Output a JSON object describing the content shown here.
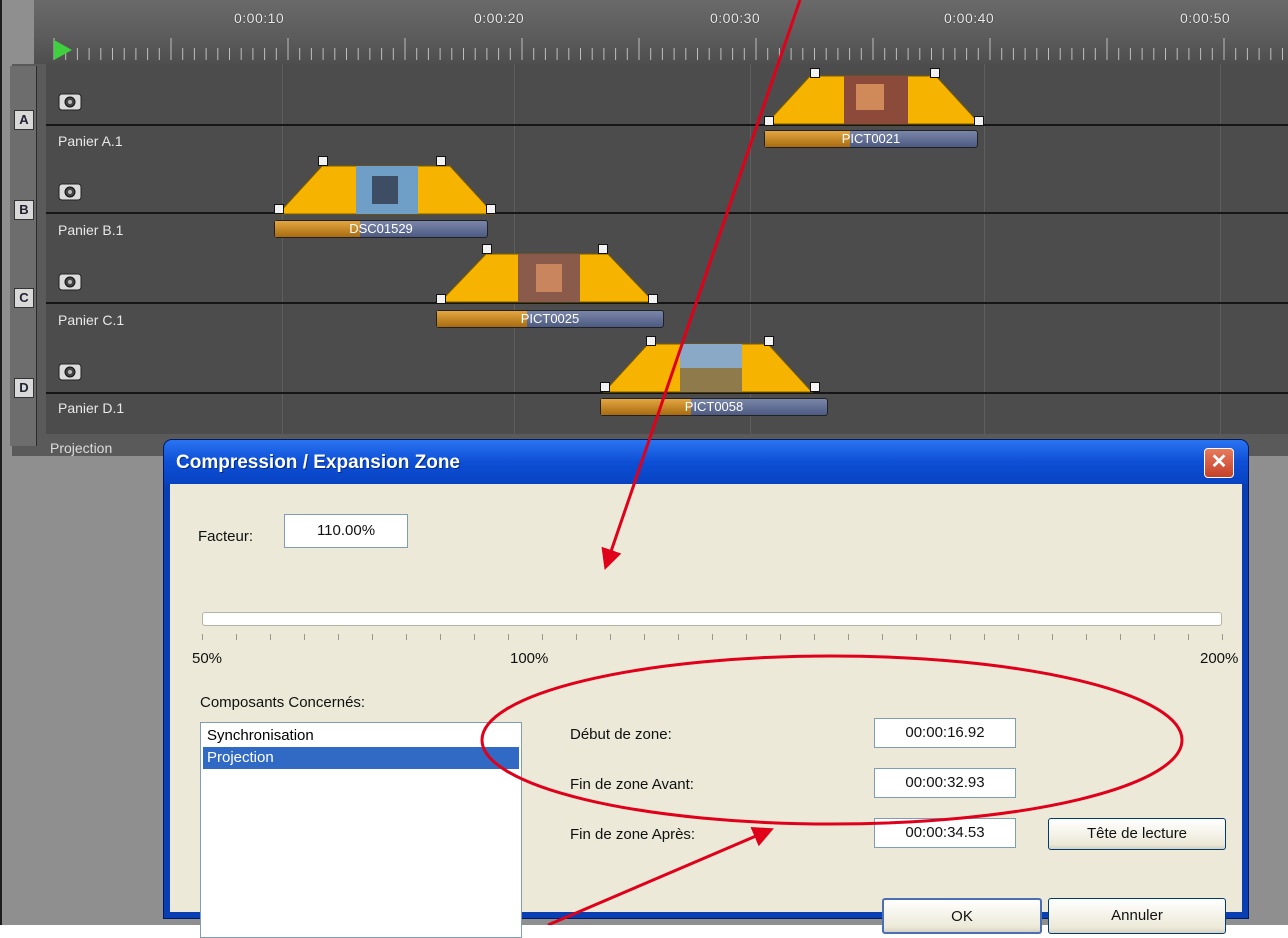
{
  "timeline": {
    "ruler_ticks": [
      "0:00:10",
      "0:00:20",
      "0:00:30",
      "0:00:40",
      "0:00:50"
    ],
    "lanes": [
      {
        "letter": "A",
        "name": "Panier A.1",
        "clip": "PICT0021"
      },
      {
        "letter": "B",
        "name": "Panier B.1",
        "clip": "DSC01529"
      },
      {
        "letter": "C",
        "name": "Panier C.1",
        "clip": "PICT0025"
      },
      {
        "letter": "D",
        "name": "Panier D.1",
        "clip": "PICT0058"
      }
    ],
    "projection_label": "Projection"
  },
  "dialog": {
    "title": "Compression / Expansion Zone",
    "factor_label": "Facteur:",
    "factor_value": "110.00%",
    "slider": {
      "min_label": "50%",
      "mid_label": "100%",
      "max_label": "200%",
      "value_percent": 110
    },
    "components_label": "Composants Concernés:",
    "components": [
      {
        "label": "Synchronisation",
        "selected": false
      },
      {
        "label": "Projection",
        "selected": true
      }
    ],
    "zone_start_label": "Début de zone:",
    "zone_start_value": "00:00:16.92",
    "zone_end_before_label": "Fin de zone Avant:",
    "zone_end_before_value": "00:00:32.93",
    "zone_end_after_label": "Fin de zone Après:",
    "zone_end_after_value": "00:00:34.53",
    "playhead_button": "Tête de lecture",
    "ok_button": "OK",
    "cancel_button": "Annuler"
  },
  "colors": {
    "annotation": "#e0001a",
    "clip_envelope": "#f6b400",
    "xp_title": "#0d4fd6",
    "selection": "#316ac5"
  }
}
